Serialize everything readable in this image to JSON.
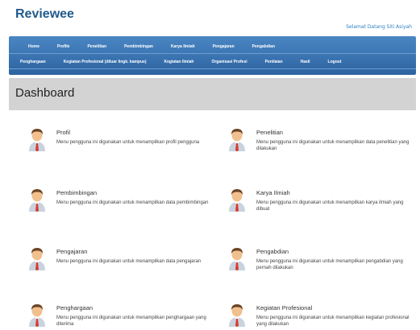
{
  "header": {
    "brand": "Reviewee",
    "welcome": "Selamat Datang Siti Asiyah"
  },
  "nav": {
    "row1": [
      "Home",
      "Profile",
      "Penelitian",
      "Pembimbingan",
      "Karya Ilmiah",
      "Pengajaran",
      "Pengabdian"
    ],
    "row2": [
      "Penghargaan",
      "Kegiatan Profesional (diluar lingk. kampus)",
      "Kegiatan Ilmiah",
      "Organisasi Profesi",
      "Penilaian",
      "Hasil",
      "Logout"
    ]
  },
  "dashboard": {
    "title": "Dashboard"
  },
  "cards": [
    {
      "title": "Profil",
      "desc": "Menu pengguna ini digunakan untuk menampilkan profil pengguna"
    },
    {
      "title": "Penelitian",
      "desc": "Menu pengguna ini digunakan untuk menampilkan data penelitian yang dilakukan"
    },
    {
      "title": "Pembimbingan",
      "desc": "Menu pengguna ini digunakan untuk menampilkan data pembimbingan"
    },
    {
      "title": "Karya Ilmiah",
      "desc": "Menu pengguna ini digunakan untuk menampilkan karya ilmiah yang dibuat"
    },
    {
      "title": "Pengajaran",
      "desc": "Menu pengguna ini digunakan untuk menampilkan data pengajaran"
    },
    {
      "title": "Pengabdian",
      "desc": "Menu pengguna ini digunakan untuk menampilkan pengabdian yang pernah dilakukan"
    },
    {
      "title": "Penghargaan",
      "desc": "Menu pengguna ini digunakan untuk menampilkan penghargaan yang diterima"
    },
    {
      "title": "Kegiatan Profesional",
      "desc": "Menu pengguna ini digunakan untuk menampilkan kegiatan profesional yang dilakukan"
    }
  ],
  "icons": {
    "card_icon": "user-avatar-icon"
  },
  "colors": {
    "nav_top": "#4a86c3",
    "nav_bottom": "#2d63a1",
    "brand": "#1f5a8c",
    "dash_bg": "#d3d3d3"
  }
}
